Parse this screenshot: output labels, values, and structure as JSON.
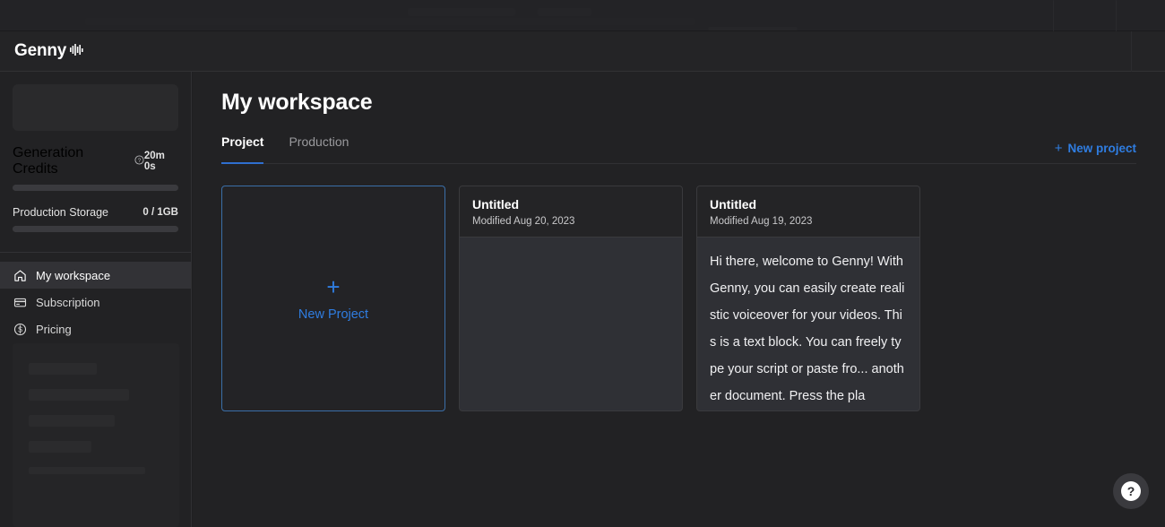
{
  "app": {
    "brand_name": "Genny",
    "brand_wave_icon": "waveform-icon"
  },
  "sidebar": {
    "meters": [
      {
        "label": "Generation Credits",
        "value": "20m 0s",
        "info_icon": "info-circle-icon",
        "percent": 0
      },
      {
        "label": "Production Storage",
        "value": "0 / 1GB",
        "percent": 0
      }
    ],
    "nav": [
      {
        "label": "My workspace",
        "icon": "home-icon",
        "active": true
      },
      {
        "label": "Subscription",
        "icon": "credit-card-icon",
        "active": false
      },
      {
        "label": "Pricing",
        "icon": "dollar-circle-icon",
        "active": false
      }
    ]
  },
  "main": {
    "title": "My workspace",
    "tabs": [
      {
        "label": "Project",
        "active": true
      },
      {
        "label": "Production",
        "active": false
      }
    ],
    "new_project_link": {
      "plus": "+",
      "label": "New project"
    },
    "new_project_card": {
      "plus": "+",
      "label": "New Project"
    },
    "projects": [
      {
        "title": "Untitled",
        "modified": "Modified Aug 20, 2023",
        "preview": ""
      },
      {
        "title": "Untitled",
        "modified": "Modified Aug 19, 2023",
        "preview": "Hi there, welcome to Genny! With Genny, you can easily create realistic voiceover for your videos. This is a text block. You can freely type your script or paste fro... another document. Press the pla"
      }
    ]
  },
  "help": {
    "icon": "question-mark-icon",
    "label": "?"
  },
  "colors": {
    "accent_blue": "#2f7de1",
    "tab_underline": "#2f6fd0",
    "sidebar_bg": "#222224",
    "card_body_bg": "#2f3035",
    "card_header_bg": "#242426"
  }
}
